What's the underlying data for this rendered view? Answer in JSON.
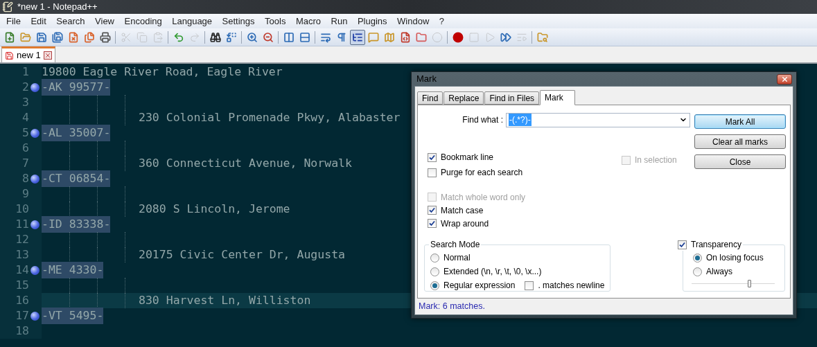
{
  "window": {
    "title": "*new 1 - Notepad++"
  },
  "menu": [
    "File",
    "Edit",
    "Search",
    "View",
    "Encoding",
    "Language",
    "Settings",
    "Tools",
    "Macro",
    "Run",
    "Plugins",
    "Window",
    "?"
  ],
  "toolbar": [
    [
      {
        "pressed": false,
        "disabled": false
      },
      {
        "pressed": false,
        "disabled": false
      },
      {
        "pressed": false,
        "disabled": false
      },
      {
        "pressed": false,
        "disabled": false
      },
      {
        "pressed": false,
        "disabled": false
      },
      {
        "pressed": false,
        "disabled": false
      },
      {
        "pressed": false,
        "disabled": false
      }
    ],
    [
      {
        "pressed": false,
        "disabled": true
      },
      {
        "pressed": false,
        "disabled": true
      },
      {
        "pressed": false,
        "disabled": true
      }
    ],
    [
      {
        "pressed": false,
        "disabled": false
      },
      {
        "pressed": false,
        "disabled": true
      }
    ],
    [
      {
        "pressed": false,
        "disabled": false
      },
      {
        "pressed": false,
        "disabled": false
      }
    ],
    [
      {
        "pressed": false,
        "disabled": false
      },
      {
        "pressed": false,
        "disabled": false
      }
    ],
    [
      {
        "pressed": false,
        "disabled": false
      },
      {
        "pressed": false,
        "disabled": false
      }
    ],
    [
      {
        "pressed": false,
        "disabled": false
      },
      {
        "pressed": false,
        "disabled": false
      },
      {
        "pressed": true,
        "disabled": false
      },
      {
        "pressed": false,
        "disabled": false
      },
      {
        "pressed": false,
        "disabled": false
      },
      {
        "pressed": false,
        "disabled": false
      },
      {
        "pressed": false,
        "disabled": false
      },
      {
        "pressed": false,
        "disabled": true
      }
    ],
    [
      {
        "pressed": false,
        "disabled": false
      },
      {
        "pressed": false,
        "disabled": true
      },
      {
        "pressed": false,
        "disabled": true
      },
      {
        "pressed": false,
        "disabled": false
      },
      {
        "pressed": false,
        "disabled": true
      }
    ],
    [
      {
        "pressed": false,
        "disabled": false
      }
    ]
  ],
  "tabs": [
    {
      "label": "new 1",
      "selected": true
    }
  ],
  "editor": {
    "lines": [
      {
        "number": "1",
        "kind": "plain",
        "text": "19800 Eagle River Road, Eagle River",
        "current": false
      },
      {
        "number": "2",
        "kind": "marked",
        "text": "-AK 99577-",
        "current": false
      },
      {
        "number": "3",
        "kind": "indented",
        "current": false
      },
      {
        "number": "4",
        "kind": "indented",
        "text": "230 Colonial Promenade Pkwy, Alabaster",
        "current": false
      },
      {
        "number": "5",
        "kind": "marked",
        "text": "-AL 35007-",
        "current": false
      },
      {
        "number": "6",
        "kind": "indented",
        "current": false
      },
      {
        "number": "7",
        "kind": "indented",
        "text": "360 Connecticut Avenue, Norwalk",
        "current": false
      },
      {
        "number": "8",
        "kind": "marked",
        "text": "-CT 06854-",
        "current": false
      },
      {
        "number": "9",
        "kind": "indented",
        "current": false
      },
      {
        "number": "10",
        "kind": "indented",
        "text": "2080 S Lincoln, Jerome",
        "current": false
      },
      {
        "number": "11",
        "kind": "marked",
        "text": "-ID 83338-",
        "current": false
      },
      {
        "number": "12",
        "kind": "indented",
        "current": false
      },
      {
        "number": "13",
        "kind": "indented",
        "text": "20175 Civic Center Dr, Augusta",
        "current": false
      },
      {
        "number": "14",
        "kind": "marked",
        "text": "-ME 4330-",
        "current": false
      },
      {
        "number": "15",
        "kind": "indented",
        "current": false
      },
      {
        "number": "16",
        "kind": "indented",
        "text": "830 Harvest Ln, Williston",
        "current": true
      },
      {
        "number": "17",
        "kind": "marked",
        "text": "-VT 5495-",
        "current": false
      },
      {
        "number": "18",
        "kind": "plain",
        "current": false
      }
    ]
  },
  "dialog": {
    "title": "Mark",
    "tabs": [
      {
        "label": "Find",
        "selected": false
      },
      {
        "label": "Replace",
        "selected": false
      },
      {
        "label": "Find in Files",
        "selected": false
      },
      {
        "label": "Mark",
        "selected": true
      }
    ],
    "find_what": {
      "label": "Find what :",
      "value": "-(.*?)-"
    },
    "buttons": [
      {
        "label": "Mark All",
        "default": true
      },
      {
        "label": "Clear all marks",
        "default": false
      },
      {
        "label": "Close",
        "default": false
      }
    ],
    "bookmark_options": [
      {
        "label": "Bookmark line",
        "checked": true,
        "disabled": false
      },
      {
        "label": "Purge for each search",
        "checked": false,
        "disabled": false
      }
    ],
    "in_selection": {
      "label": "In selection",
      "checked": false,
      "disabled": true
    },
    "match_options": [
      {
        "label": "Match whole word only",
        "checked": false,
        "disabled": true
      },
      {
        "label": "Match case",
        "checked": true,
        "disabled": false
      },
      {
        "label": "Wrap around",
        "checked": true,
        "disabled": false
      }
    ],
    "search_mode": {
      "title": "Search Mode",
      "modes": [
        {
          "label": "Normal",
          "selected": false
        },
        {
          "label": "Extended (\\n, \\r, \\t, \\0, \\x...)",
          "selected": false
        },
        {
          "label": "Regular expression",
          "selected": true
        }
      ],
      "dot_newline": {
        "label": ". matches newline",
        "checked": false,
        "disabled": false
      }
    },
    "transparency": {
      "label": "Transparency",
      "checked": true,
      "disabled": false,
      "modes": [
        {
          "label": "On losing focus",
          "selected": true
        },
        {
          "label": "Always",
          "selected": false
        }
      ],
      "level": 0.7
    },
    "status": "Mark: 6 matches."
  }
}
